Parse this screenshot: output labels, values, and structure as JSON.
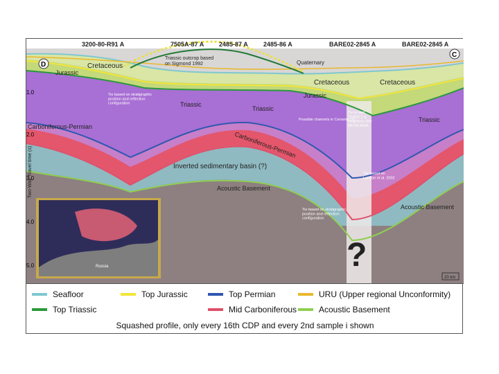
{
  "profile_labels": [
    "3200-80-R91 A",
    "7505A-87 A",
    "2485-87 A",
    "2485-86 A",
    "BARE02-2845 A",
    "BARE02-2845 A"
  ],
  "corner_labels": {
    "left": "D",
    "right": "C"
  },
  "y_axis": {
    "label": "Two-Way Travel time (s)",
    "ticks": [
      "1.0",
      "2.0",
      "3.0",
      "4.0",
      "5.0"
    ]
  },
  "unit_labels": {
    "cretaceous_left": "Cretaceous",
    "jurassic_left": "Jurassic",
    "triassic_outcrop": "Triassic outcrop based\non Sigmond 1992",
    "quaternary": "Quaternary",
    "cretaceous_mid": "Cretaceous",
    "cretaceous_right": "Cretaceous",
    "jurassic_right": "Jurassic",
    "tie_left": "Tie based on stratigraphic\nposition and reflection\nconfiguration",
    "triassic_1": "Triassic",
    "triassic_2": "Triassic",
    "triassic_3": "Triassic",
    "carboniferous_left": "Carboniferous-Permian",
    "carboniferous_mid": "Carboniferous-Permian",
    "possible_channels": "Possible channels in Cenoma (?)",
    "tie_well": "Tie to well\n7226/2-1 &\nneighbour line\nMh 93-402A",
    "tie_right": "Tie based on\nLandon et al. 2002",
    "inverted_basin": "Inverted sedimentary basin (?)",
    "acoustic_basement_mid": "Acoustic Basement",
    "tie_bottom": "Tie based on stratigraphic\nposition and reflection\nconfiguration",
    "acoustic_basement_right": "Acoustic Basement",
    "question": "?",
    "scale": "20 km",
    "map_label": "Russia"
  },
  "legend": [
    {
      "label": "Seafloor",
      "color": "#7fc7d0"
    },
    {
      "label": "Top Jurassic",
      "color": "#f2e53a"
    },
    {
      "label": "Top Permian",
      "color": "#2f57b0"
    },
    {
      "label": "URU (Upper regional Unconformity)",
      "color": "#e8b82e"
    },
    {
      "label": "Top Triassic",
      "color": "#2b9a3a"
    },
    {
      "label": "Mid Carboniferous",
      "color": "#e04f6a"
    },
    {
      "label": "Acoustic Basement",
      "color": "#8fcf52"
    }
  ],
  "caption": "Squashed profile, only every 16th CDP and every 2nd sample i shown"
}
